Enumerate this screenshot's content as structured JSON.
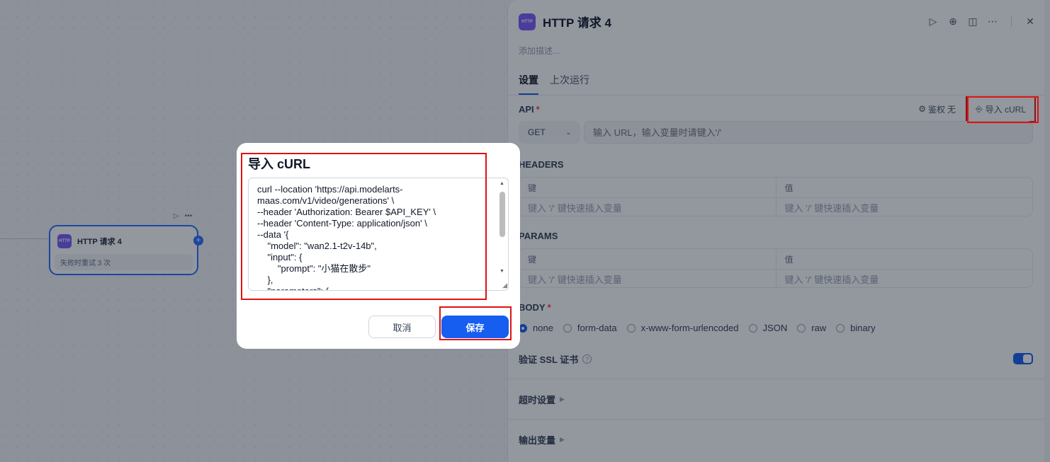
{
  "canvas": {
    "node": {
      "icon_text": "HTTP",
      "title": "HTTP 请求 4",
      "subtitle": "失败时重试 3 次",
      "run_icon": "play-icon",
      "more_icon": "more-icon"
    }
  },
  "panel": {
    "icon_text": "HTTP",
    "title": "HTTP 请求 4",
    "description_placeholder": "添加描述...",
    "tabs": [
      {
        "label": "设置",
        "active": true
      },
      {
        "label": "上次运行",
        "active": false
      }
    ],
    "api": {
      "label": "API",
      "required_mark": "*",
      "auth_label": "鉴权",
      "auth_value": "无",
      "import_label": "导入 cURL",
      "method": "GET",
      "url_placeholder": "输入 URL，输入变量时请键入'/'"
    },
    "headers": {
      "label": "HEADERS",
      "key_col": "键",
      "value_col": "值",
      "key_placeholder": "键入 '/' 键快速插入变量",
      "value_placeholder": "键入 '/' 键快速插入变量"
    },
    "params": {
      "label": "PARAMS",
      "key_col": "键",
      "value_col": "值",
      "key_placeholder": "键入 '/' 键快速插入变量",
      "value_placeholder": "键入 '/' 键快速插入变量"
    },
    "body": {
      "label": "BODY",
      "required_mark": "*",
      "options": [
        "none",
        "form-data",
        "x-www-form-urlencoded",
        "JSON",
        "raw",
        "binary"
      ],
      "selected": "none"
    },
    "ssl": {
      "label": "验证 SSL 证书",
      "help": "?",
      "enabled": true
    },
    "timeout_label": "超时设置",
    "output_label": "输出变量"
  },
  "modal": {
    "title": "导入 cURL",
    "curl_text": "curl --location 'https://api.modelarts-maas.com/v1/video/generations' \\\n--header 'Authorization: Bearer $API_KEY' \\\n--header 'Content-Type: application/json' \\\n--data '{\n    \"model\": \"wan2.1-t2v-14b\",\n    \"input\": {\n        \"prompt\": \"小猫在散步\"\n    },\n    \"parameters\": {",
    "cancel_label": "取消",
    "save_label": "保存"
  },
  "colors": {
    "primary": "#155eef",
    "highlight": "#e01212",
    "node_icon": "#7a5af8"
  }
}
